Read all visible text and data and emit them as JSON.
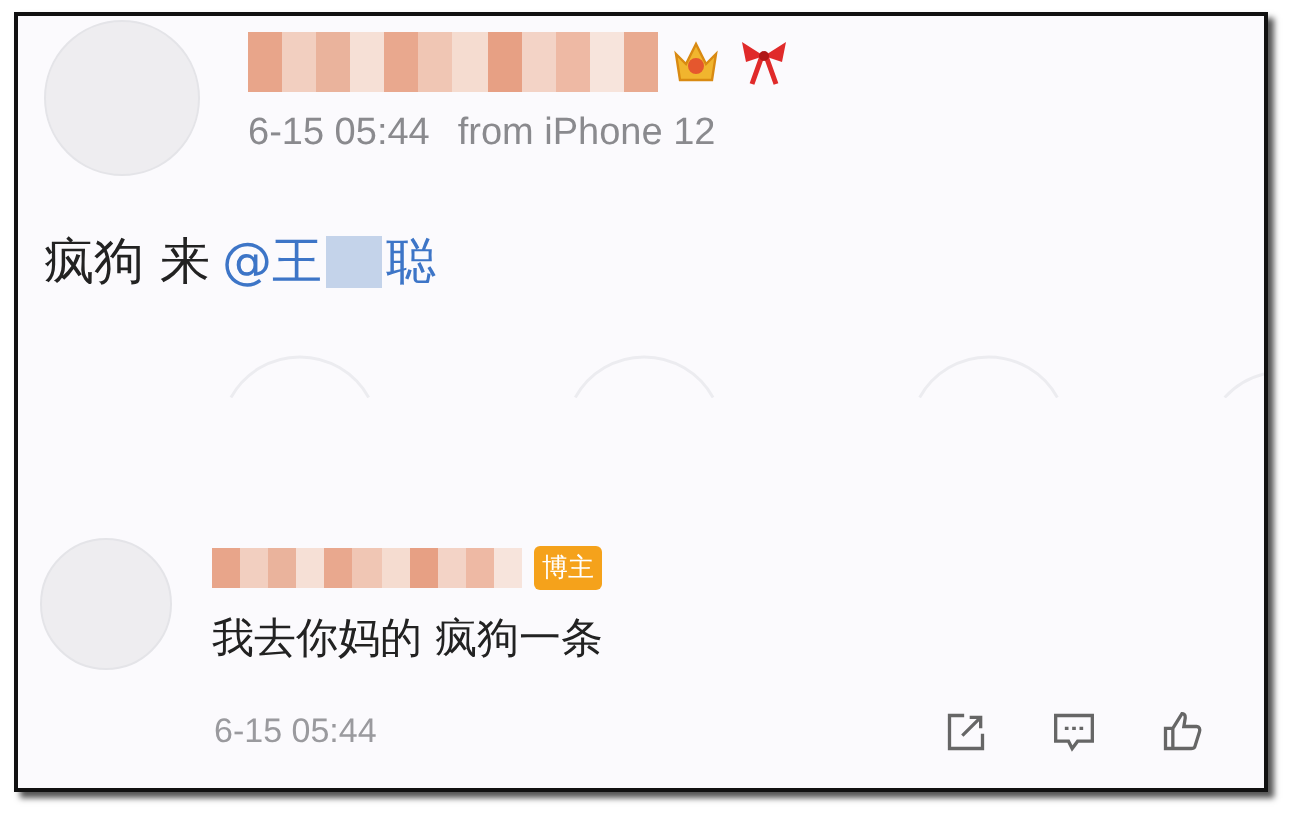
{
  "post": {
    "time": "6-15 05:44",
    "source": "from iPhone 12",
    "text": "疯狗 来",
    "mention_before": "@王",
    "mention_after": "聪",
    "name_hidden": true
  },
  "comment": {
    "badge": "博主",
    "text": "我去你妈的 疯狗一条",
    "time": "6-15 05:44",
    "name_hidden": true
  }
}
